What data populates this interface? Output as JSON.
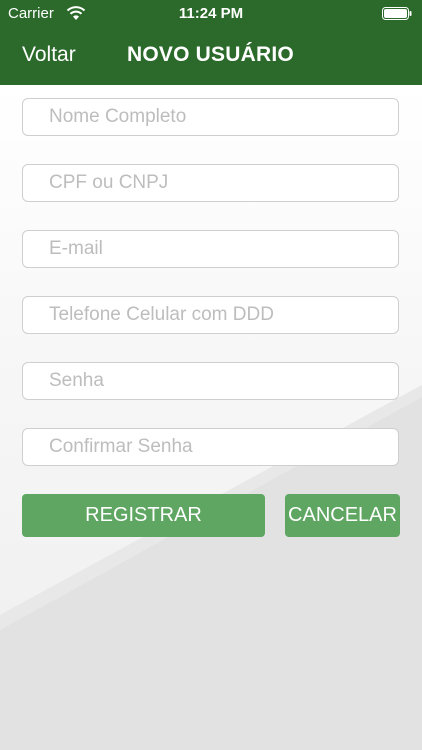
{
  "status_bar": {
    "carrier": "Carrier",
    "time": "11:24 PM"
  },
  "nav": {
    "back_label": "Voltar",
    "title": "NOVO USUÁRIO"
  },
  "form": {
    "name_placeholder": "Nome Completo",
    "doc_placeholder": "CPF ou CNPJ",
    "email_placeholder": "E-mail",
    "phone_placeholder": "Telefone Celular com DDD",
    "password_placeholder": "Senha",
    "confirm_placeholder": "Confirmar Senha"
  },
  "actions": {
    "register_label": "REGISTRAR",
    "cancel_label": "CANCELAR"
  },
  "colors": {
    "header": "#2b6a2b",
    "button": "#5fa662"
  }
}
